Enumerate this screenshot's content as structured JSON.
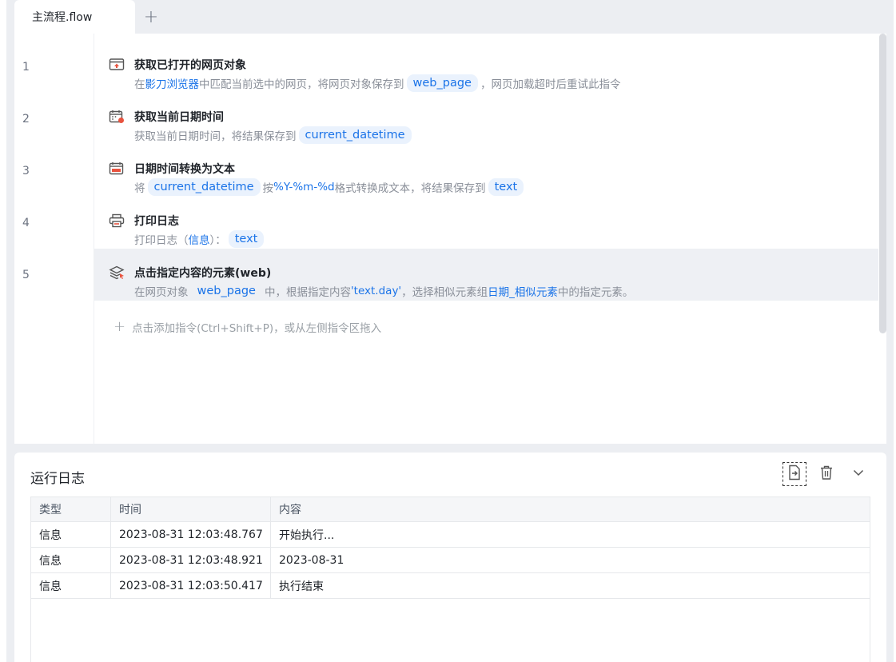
{
  "tab": {
    "label": "主流程.flow",
    "add_label": "+"
  },
  "steps": [
    {
      "line": "1",
      "title": "获取已打开的网页对象",
      "desc": {
        "p1": "在",
        "hl1": "影刀浏览器",
        "p2": "中匹配当前选中的网页，将网页对象保存到",
        "chip1": "web_page",
        "p3": "，网页加载超时后重试此指令"
      }
    },
    {
      "line": "2",
      "title": "获取当前日期时间",
      "desc": {
        "p1": "获取当前日期时间，将结果保存到",
        "chip1": "current_datetime"
      }
    },
    {
      "line": "3",
      "title": "日期时间转换为文本",
      "desc": {
        "p1": "将",
        "chip1": "current_datetime",
        "p2": "按",
        "hl1": "%Y-%m-%d",
        "p3": "格式转换成文本，将结果保存到",
        "chip2": "text"
      }
    },
    {
      "line": "4",
      "title": "打印日志",
      "desc": {
        "p1": "打印日志（",
        "hl1": "信息",
        "p2": "）：",
        "chip1": "text"
      }
    },
    {
      "line": "5",
      "title": "点击指定内容的元素(web)",
      "desc": {
        "p1": "在网页对象",
        "chip1": "web_page",
        "p2": "中，根据指定内容",
        "hl1": "'text.day'",
        "p3": "，选择相似元素组",
        "hl2": "日期_相似元素",
        "p4": "中的指定元素。"
      }
    }
  ],
  "add_command": "点击添加指令(Ctrl+Shift+P)，或从左侧指令区拖入",
  "log": {
    "title": "运行日志",
    "columns": [
      "类型",
      "时间",
      "内容"
    ],
    "rows": [
      {
        "type": "信息",
        "time": "2023-08-31 12:03:48.767",
        "content": "开始执行..."
      },
      {
        "type": "信息",
        "time": "2023-08-31 12:03:48.921",
        "content": "2023-08-31"
      },
      {
        "type": "信息",
        "time": "2023-08-31 12:03:50.417",
        "content": "执行结束"
      }
    ]
  },
  "colors": {
    "accent": "#1a73e8",
    "chip_bg": "#eaf2fd",
    "selected_row": "#eef0f4"
  }
}
